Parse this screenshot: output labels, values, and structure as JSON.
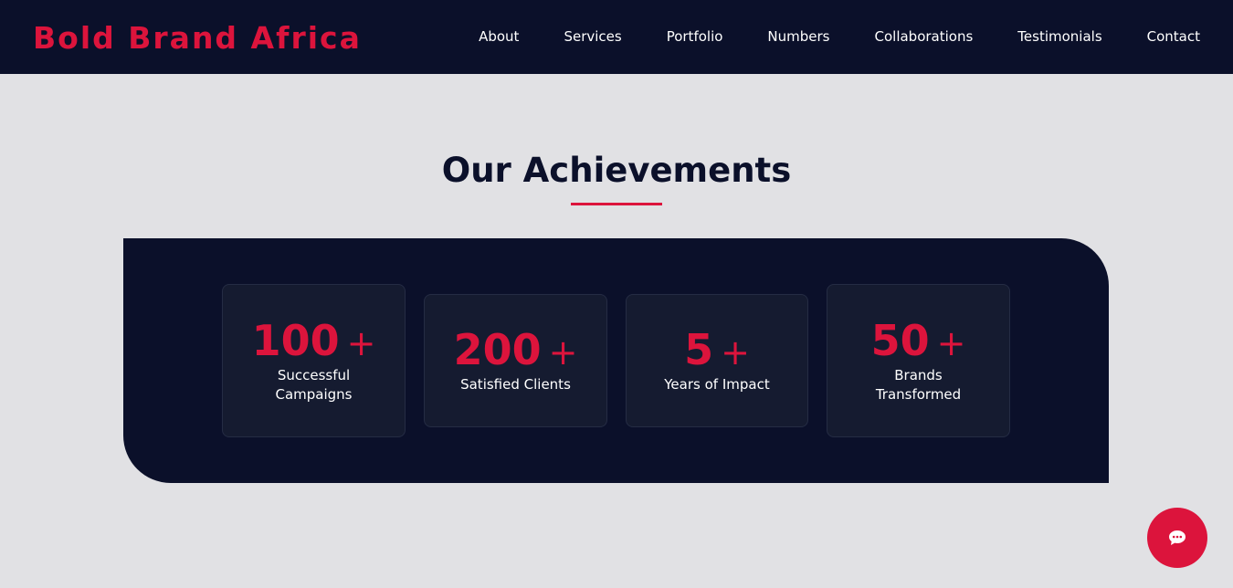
{
  "header": {
    "brand": "Bold Brand Africa",
    "nav": [
      "About",
      "Services",
      "Portfolio",
      "Numbers",
      "Collaborations",
      "Testimonials",
      "Contact"
    ]
  },
  "achievements": {
    "title": "Our Achievements",
    "stats": [
      {
        "number": "100",
        "suffix": "+",
        "label": "Successful Campaigns"
      },
      {
        "number": "200",
        "suffix": "+",
        "label": "Satisfied Clients"
      },
      {
        "number": "5",
        "suffix": "+",
        "label": "Years of Impact"
      },
      {
        "number": "50",
        "suffix": "+",
        "label": "Brands Transformed"
      }
    ]
  },
  "colors": {
    "navy": "#0b102a",
    "accent": "#dc143c",
    "card": "#151b30",
    "page_bg": "#e1e1e4"
  },
  "chat": {
    "icon": "chat-bubble-icon"
  }
}
